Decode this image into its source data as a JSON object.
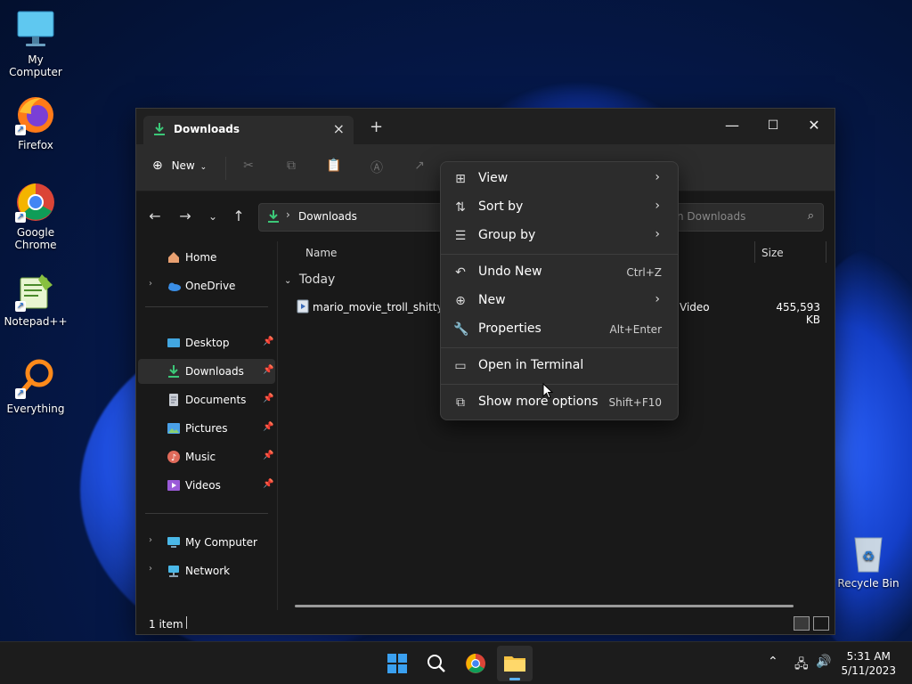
{
  "desktop": {
    "icons": [
      {
        "label": "My Computer"
      },
      {
        "label": "Firefox"
      },
      {
        "label": "Google Chrome"
      },
      {
        "label": "Notepad++"
      },
      {
        "label": "Everything"
      },
      {
        "label": "Recycle Bin"
      }
    ]
  },
  "explorer": {
    "tab_title": "Downloads",
    "toolbar": {
      "new_label": "New"
    },
    "address": {
      "path": "Downloads"
    },
    "search": {
      "placeholder": "n Downloads"
    },
    "sidebar": {
      "items": [
        {
          "label": "Home"
        },
        {
          "label": "OneDrive"
        },
        {
          "label": "Desktop"
        },
        {
          "label": "Downloads"
        },
        {
          "label": "Documents"
        },
        {
          "label": "Pictures"
        },
        {
          "label": "Music"
        },
        {
          "label": "Videos"
        },
        {
          "label": "My Computer"
        },
        {
          "label": "Network"
        }
      ]
    },
    "columns": {
      "name": "Name",
      "size": "Size"
    },
    "group": "Today",
    "files": [
      {
        "name": "mario_movie_troll_shitty_ca",
        "type": "Video",
        "size": "455,593 KB"
      }
    ],
    "status": {
      "count": "1 item"
    }
  },
  "context_menu": {
    "items": [
      {
        "label": "View",
        "shortcut": ""
      },
      {
        "label": "Sort by",
        "shortcut": ""
      },
      {
        "label": "Group by",
        "shortcut": ""
      },
      {
        "label": "Undo New",
        "shortcut": "Ctrl+Z"
      },
      {
        "label": "New",
        "shortcut": ""
      },
      {
        "label": "Properties",
        "shortcut": "Alt+Enter"
      },
      {
        "label": "Open in Terminal",
        "shortcut": ""
      },
      {
        "label": "Show more options",
        "shortcut": "Shift+F10"
      }
    ]
  },
  "taskbar": {
    "time": "5:31 AM",
    "date": "5/11/2023"
  }
}
